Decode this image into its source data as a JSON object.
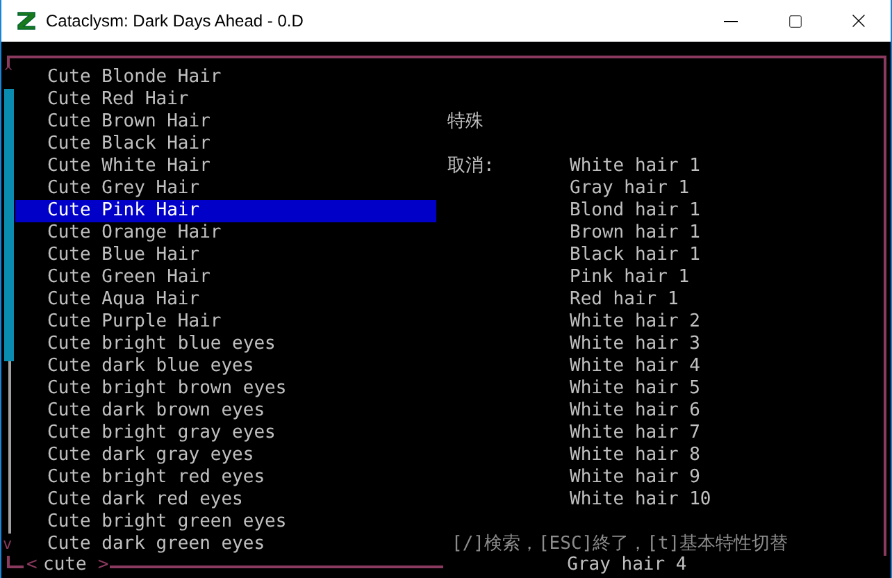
{
  "window": {
    "title": "Cataclysm: Dark Days Ahead - 0.D"
  },
  "scroll": {
    "up": "^",
    "down": "v"
  },
  "items": [
    {
      "label": "Cute Blonde Hair",
      "selected": false
    },
    {
      "label": "Cute Red Hair",
      "selected": false
    },
    {
      "label": "Cute Brown Hair",
      "selected": false
    },
    {
      "label": "Cute Black Hair",
      "selected": false
    },
    {
      "label": "Cute White Hair",
      "selected": false
    },
    {
      "label": "Cute Grey Hair",
      "selected": false
    },
    {
      "label": "Cute Pink Hair",
      "selected": true
    },
    {
      "label": "Cute Orange Hair",
      "selected": false
    },
    {
      "label": "Cute Blue Hair",
      "selected": false
    },
    {
      "label": "Cute Green Hair",
      "selected": false
    },
    {
      "label": "Cute Aqua Hair",
      "selected": false
    },
    {
      "label": "Cute Purple Hair",
      "selected": false
    },
    {
      "label": "Cute bright blue eyes",
      "selected": false
    },
    {
      "label": "Cute dark blue eyes",
      "selected": false
    },
    {
      "label": "Cute bright brown eyes",
      "selected": false
    },
    {
      "label": "Cute dark brown eyes",
      "selected": false
    },
    {
      "label": "Cute bright gray eyes",
      "selected": false
    },
    {
      "label": "Cute dark gray eyes",
      "selected": false
    },
    {
      "label": "Cute bright red eyes",
      "selected": false
    },
    {
      "label": "Cute dark red eyes",
      "selected": false
    },
    {
      "label": "Cute bright green eyes",
      "selected": false
    },
    {
      "label": "Cute dark green eyes",
      "selected": false
    }
  ],
  "detail": {
    "category": "特殊",
    "cancels_label": "取消:",
    "cancels": [
      "White hair 1",
      "Gray hair 1",
      "Blond hair 1",
      "Brown hair 1",
      "Black hair 1",
      "Pink hair 1",
      "Red hair 1",
      "White hair 2",
      "White hair 3",
      "White hair 4",
      "White hair 5",
      "White hair 6",
      "White hair 7",
      "White hair 8",
      "White hair 9",
      "White hair 10"
    ],
    "cancels_below_footer": [
      "Gray hair 4"
    ]
  },
  "hint": "[/]検索，[ESC]終了，[t]基本特性切替",
  "filter": {
    "open": "<",
    "text": "cute",
    "close": ">"
  }
}
